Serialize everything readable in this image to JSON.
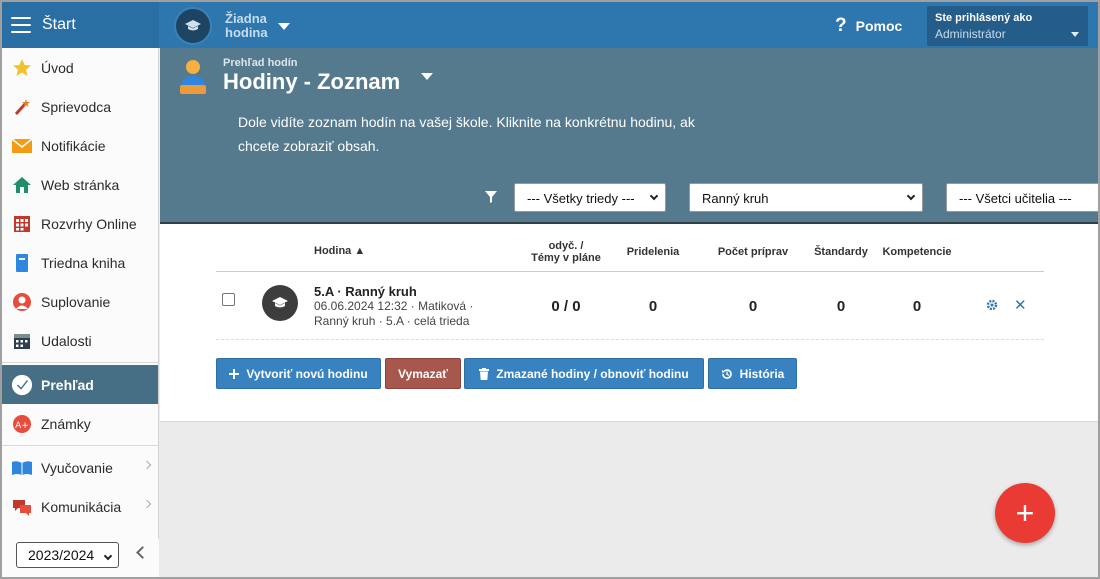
{
  "topbar": {
    "brand": "Štart",
    "lesson_line1": "Žiadna",
    "lesson_line2": "hodina",
    "help": "Pomoc",
    "user_label": "Ste prihlásený ako",
    "user_name": "Administrátor"
  },
  "sidebar": {
    "items": [
      {
        "label": "Úvod",
        "icon": "star-icon"
      },
      {
        "label": "Sprievodca",
        "icon": "wand-icon"
      },
      {
        "label": "Notifikácie",
        "icon": "envelope-icon"
      },
      {
        "label": "Web stránka",
        "icon": "house-icon"
      },
      {
        "label": "Rozvrhy Online",
        "icon": "calendar-grid-icon"
      },
      {
        "label": "Triedna kniha",
        "icon": "book-icon"
      },
      {
        "label": "Suplovanie",
        "icon": "person-icon"
      },
      {
        "label": "Udalosti",
        "icon": "calendar-icon"
      }
    ],
    "active": {
      "label": "Prehľad",
      "icon": "check-circle-icon"
    },
    "znamky": {
      "label": "Známky",
      "icon": "grade-icon"
    },
    "groups": [
      {
        "label": "Vyučovanie",
        "icon": "open-book-icon"
      },
      {
        "label": "Komunikácia",
        "icon": "chat-icon"
      }
    ],
    "year": "2023/2024"
  },
  "header": {
    "breadcrumb": "Prehľad hodín",
    "title": "Hodiny - Zoznam",
    "description": "Dole vidíte zoznam hodín na vašej škole. Kliknite na konkrétnu hodinu, ak chcete zobraziť obsah.",
    "filters": {
      "classes": "--- Všetky triedy ---",
      "subject": "Ranný kruh",
      "teachers": "--- Všetci učitelia ---"
    }
  },
  "table": {
    "headers": {
      "lesson": "Hodina ▲",
      "taught_l1": "odуč. /",
      "taught_l2": "Témy v pláne",
      "assignments": "Pridelenia",
      "preparations": "Počet príprav",
      "standards": "Štandardy",
      "competencies": "Kompetencie"
    },
    "rows": [
      {
        "title": "5.A · Ranný kruh",
        "meta": "06.06.2024 12:32 · Matiková · Ranný kruh · 5.A · celá trieda",
        "taught": "0 / 0",
        "assignments": "0",
        "preparations": "0",
        "standards": "0",
        "competencies": "0"
      }
    ]
  },
  "actions": {
    "create": "Vytvoriť novú hodinu",
    "delete": "Vymazať",
    "deleted": "Zmazané hodiny / obnoviť hodinu",
    "history": "História"
  },
  "fab": "+",
  "colors": {
    "topbar": "#2e76ae",
    "header_panel": "#557a8e",
    "sidebar_active": "#466f86",
    "button_blue": "#3782bf",
    "button_red": "#a7574b",
    "fab": "#e93a33"
  }
}
